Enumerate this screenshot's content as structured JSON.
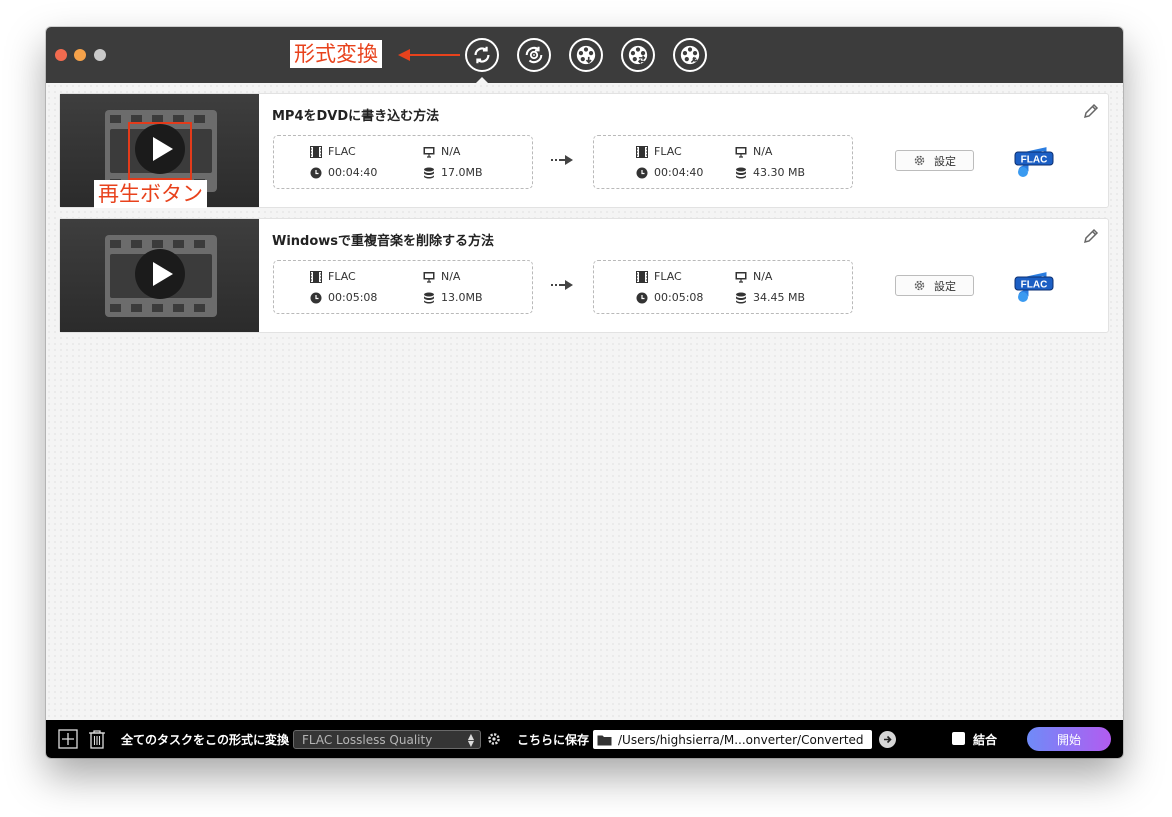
{
  "toolbar": {
    "buttons": [
      {
        "id": "convert",
        "icon": "convert-icon",
        "active": true
      },
      {
        "id": "rip",
        "icon": "disc-rip-icon",
        "active": false
      },
      {
        "id": "burn",
        "icon": "film-reel-download-icon",
        "active": false
      },
      {
        "id": "transfer",
        "icon": "film-reel-transfer-icon",
        "active": false
      },
      {
        "id": "toolbox",
        "icon": "film-reel-tools-icon",
        "active": false
      }
    ]
  },
  "annotations": {
    "convert_label": "形式変換",
    "play_label": "再生ボタン",
    "color": "#e8421c"
  },
  "tasks": [
    {
      "title": "MP4をDVDに書き込む方法",
      "source": {
        "format": "FLAC",
        "resolution": "N/A",
        "duration": "00:04:40",
        "size": "17.0MB"
      },
      "output": {
        "format": "FLAC",
        "resolution": "N/A",
        "duration": "00:04:40",
        "size": "43.30 MB"
      },
      "settings_label": "設定",
      "badge": "FLAC"
    },
    {
      "title": "Windowsで重複音楽を削除する方法",
      "source": {
        "format": "FLAC",
        "resolution": "N/A",
        "duration": "00:05:08",
        "size": "13.0MB"
      },
      "output": {
        "format": "FLAC",
        "resolution": "N/A",
        "duration": "00:05:08",
        "size": "34.45 MB"
      },
      "settings_label": "設定",
      "badge": "FLAC"
    }
  ],
  "bottom": {
    "convert_all_label": "全てのタスクをこの形式に変換",
    "format_value": "FLAC Lossless Quality",
    "save_label": "こちらに保存",
    "path_value": "/Users/highsierra/M...onverter/Converted",
    "merge_label": "結合",
    "start_label": "開始"
  },
  "colors": {
    "titlebar": "#3c3c3c",
    "accent_start": "#6f8bf8",
    "accent_end": "#b25cf0",
    "highlight": "#e23b1b"
  }
}
